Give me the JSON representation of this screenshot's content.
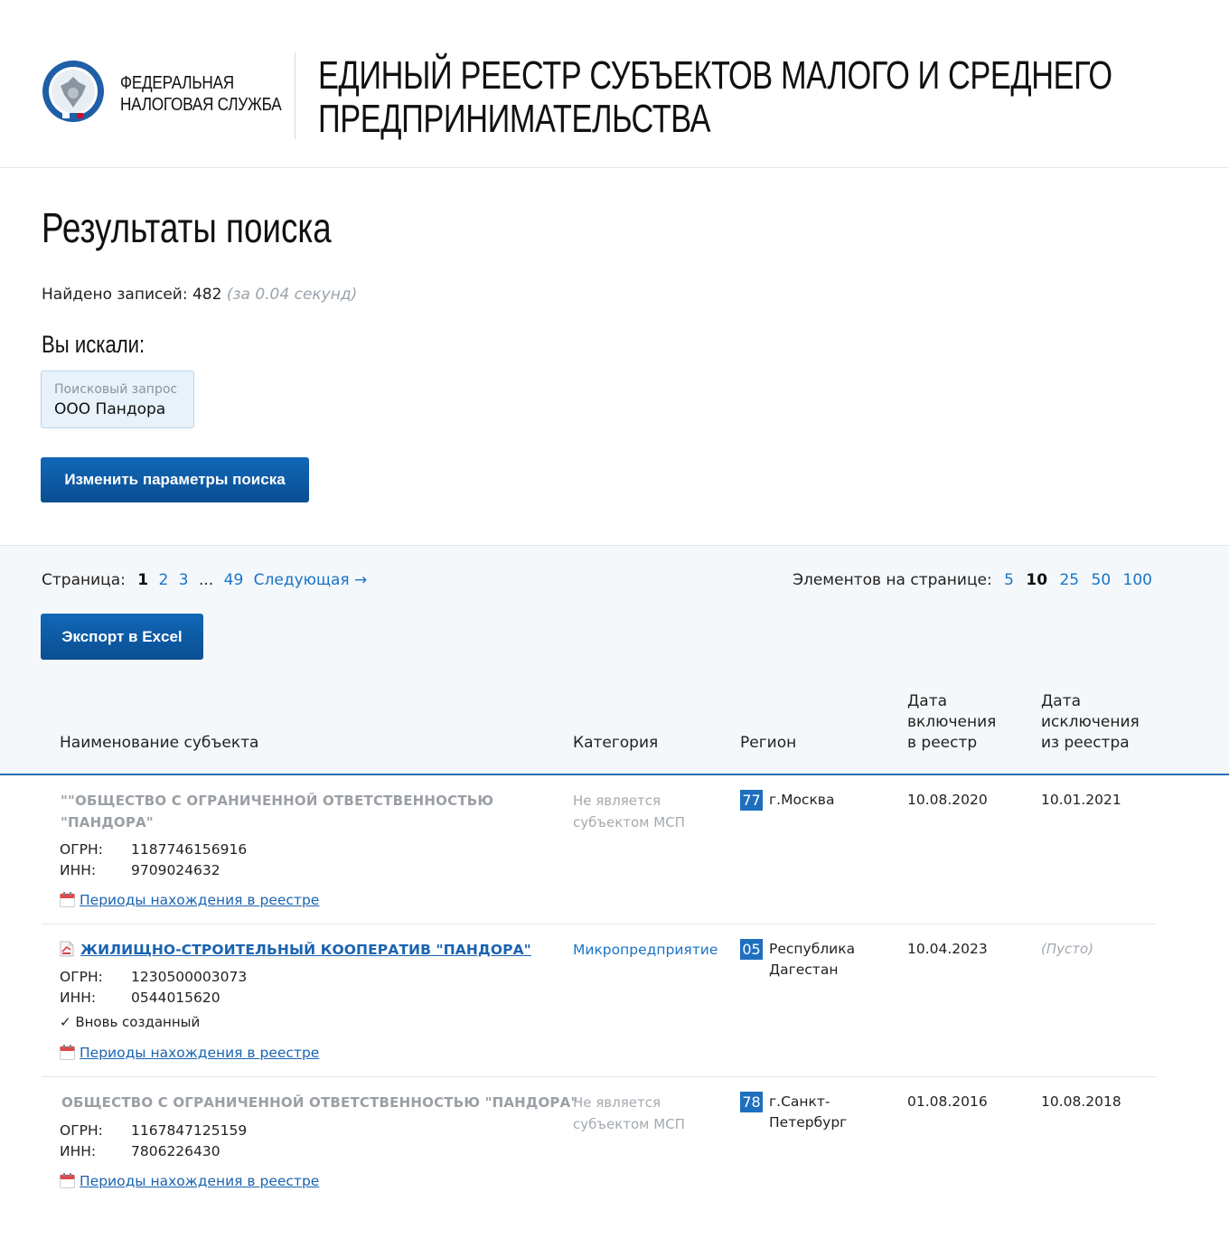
{
  "header": {
    "org_line1": "ФЕДЕРАЛЬНАЯ",
    "org_line2": "НАЛОГОВАЯ СЛУЖБА",
    "title_line1": "ЕДИНЫЙ РЕЕСТР СУБЪЕКТОВ МАЛОГО И СРЕДНЕГО",
    "title_line2": "ПРЕДПРИНИМАТЕЛЬСТВА"
  },
  "search": {
    "page_title": "Результаты поиска",
    "found_label": "Найдено записей: 482",
    "found_time": "(за 0.04 секунд)",
    "you_searched": "Вы искали:",
    "query_label": "Поисковый запрос",
    "query_value": "ООО Пандора",
    "change_button": "Изменить параметры поиска"
  },
  "pagination": {
    "label": "Страница:",
    "current": "1",
    "pages": [
      "2",
      "3"
    ],
    "ellipsis": "...",
    "last": "49",
    "next": "Следующая →",
    "per_page_label": "Элементов на странице:",
    "per_page_before": [
      "5"
    ],
    "per_page_current": "10",
    "per_page_after": [
      "25",
      "50",
      "100"
    ]
  },
  "export_button": "Экспорт в Excel",
  "table": {
    "headers": {
      "name": "Наименование субъекта",
      "category": "Категория",
      "region": "Регион",
      "included_1": "Дата",
      "included_2": "включения",
      "included_3": "в реестр",
      "excluded_1": "Дата",
      "excluded_2": "исключения",
      "excluded_3": "из реестра"
    },
    "ogrn_label": "ОГРН:",
    "inn_label": "ИНН:",
    "periods_link": "Периоды нахождения в реестре",
    "rows": [
      {
        "name_line1": "\"\"ОБЩЕСТВО С ОГРАНИЧЕННОЙ ОТВЕТСТВЕННОСТЬЮ",
        "name_line2": "\"ПАНДОРА\"",
        "ogrn": "1187746156916",
        "inn": "9709024632",
        "category_line1": "Не является",
        "category_line2": "субъектом МСП",
        "region_code": "77",
        "region_line1": "г.Москва",
        "region_line2": "",
        "included": "10.08.2020",
        "excluded": "10.01.2021"
      },
      {
        "name": "ЖИЛИЩНО-СТРОИТЕЛЬНЫЙ КООПЕРАТИВ \"ПАНДОРА\"",
        "ogrn": "1230500003073",
        "inn": "0544015620",
        "status": "✓ Вновь созданный",
        "category": "Микропредприятие",
        "region_code": "05",
        "region_line1": "Республика",
        "region_line2": "Дагестан",
        "included": "10.04.2023",
        "excluded": "(Пусто)"
      },
      {
        "name": "ОБЩЕСТВО С ОГРАНИЧЕННОЙ ОТВЕТСТВЕННОСТЬЮ \"ПАНДОРА\"",
        "ogrn": "1167847125159",
        "inn": "7806226430",
        "category_line1": "Не является",
        "category_line2": "субъектом МСП",
        "region_code": "78",
        "region_line1": "г.Санкт-",
        "region_line2": "Петербург",
        "included": "01.08.2016",
        "excluded": "10.08.2018"
      }
    ]
  }
}
